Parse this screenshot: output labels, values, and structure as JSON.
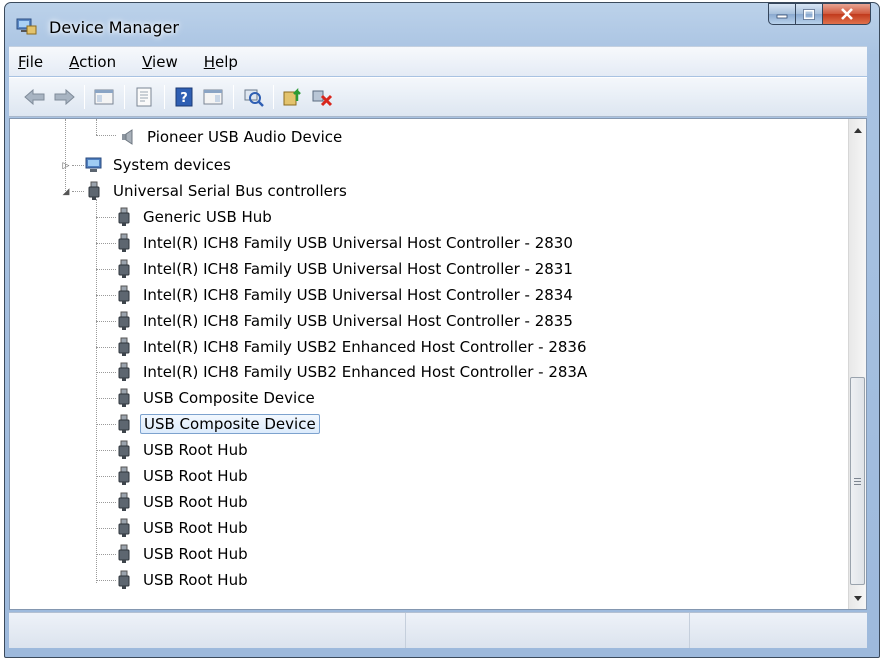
{
  "window": {
    "title": "Device Manager"
  },
  "menu": {
    "items": [
      {
        "pre": "",
        "key": "F",
        "post": "ile"
      },
      {
        "pre": "",
        "key": "A",
        "post": "ction"
      },
      {
        "pre": "",
        "key": "V",
        "post": "iew"
      },
      {
        "pre": "",
        "key": "H",
        "post": "elp"
      }
    ]
  },
  "toolbar": {
    "icons": [
      "back-arrow-icon",
      "forward-arrow-icon",
      "show-hide-console-tree-icon",
      "properties-icon",
      "help-icon",
      "action-pane-icon",
      "scan-hardware-changes-icon",
      "update-driver-icon",
      "uninstall-device-icon"
    ]
  },
  "tree": {
    "partial_item": "Pioneer USB Audio Device",
    "system_devices": "System devices",
    "usb_controllers": "Universal Serial Bus controllers",
    "usb_children": [
      "Generic USB Hub",
      "Intel(R) ICH8 Family USB Universal Host Controller - 2830",
      "Intel(R) ICH8 Family USB Universal Host Controller - 2831",
      "Intel(R) ICH8 Family USB Universal Host Controller - 2834",
      "Intel(R) ICH8 Family USB Universal Host Controller - 2835",
      "Intel(R) ICH8 Family USB2 Enhanced Host Controller - 2836",
      "Intel(R) ICH8 Family USB2 Enhanced Host Controller - 283A",
      "USB Composite Device",
      "USB Composite Device",
      "USB Root Hub",
      "USB Root Hub",
      "USB Root Hub",
      "USB Root Hub",
      "USB Root Hub",
      "USB Root Hub"
    ],
    "selected_index": 8
  },
  "colors": {
    "selection_border": "#7da2ce",
    "close_button": "#c13a1d",
    "frame": "#a9c3e2"
  }
}
